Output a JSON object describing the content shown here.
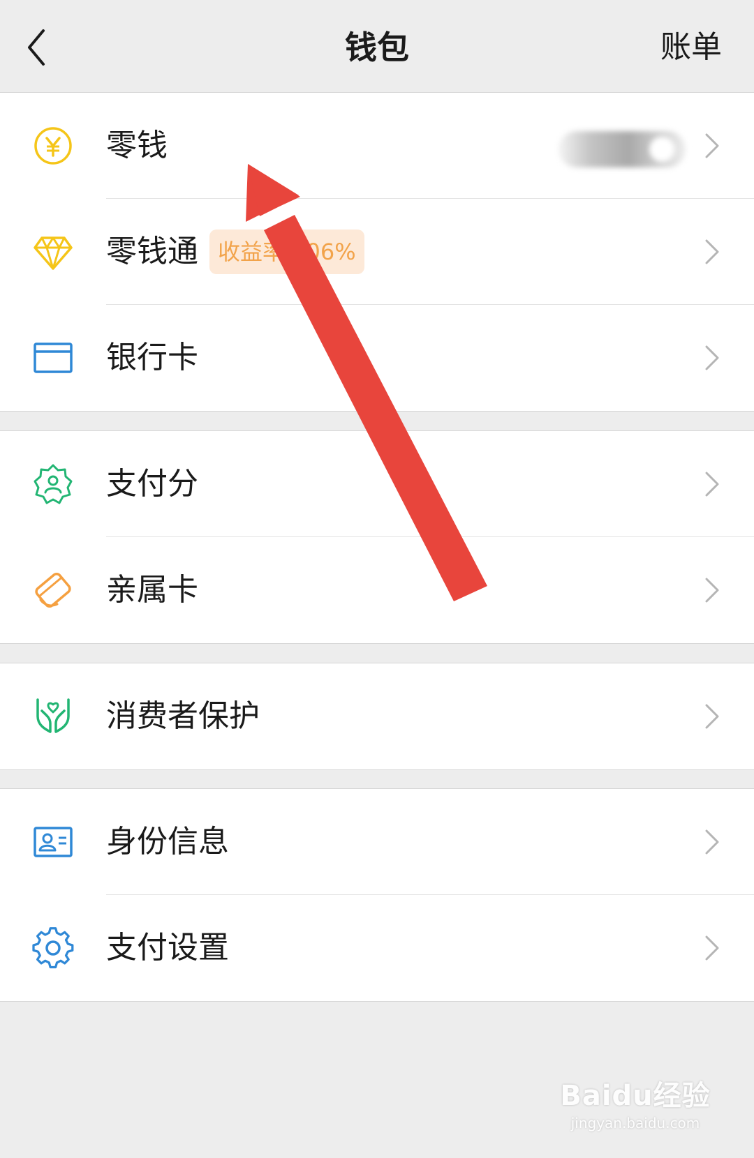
{
  "nav": {
    "title": "钱包",
    "action": "账单"
  },
  "groups": [
    {
      "items": [
        {
          "label": "零钱",
          "icon": "yuan-coin-icon",
          "color": "#f5c518"
        },
        {
          "label": "零钱通",
          "icon": "diamond-icon",
          "color": "#f5c518",
          "badge": "收益率2.06%"
        },
        {
          "label": "银行卡",
          "icon": "bank-card-icon",
          "color": "#2f88d6"
        }
      ]
    },
    {
      "items": [
        {
          "label": "支付分",
          "icon": "payment-score-badge-icon",
          "color": "#22b573"
        },
        {
          "label": "亲属卡",
          "icon": "family-card-icon",
          "color": "#f5a040"
        }
      ]
    },
    {
      "items": [
        {
          "label": "消费者保护",
          "icon": "hands-protect-icon",
          "color": "#22b573"
        }
      ]
    },
    {
      "items": [
        {
          "label": "身份信息",
          "icon": "id-card-icon",
          "color": "#2f88d6"
        },
        {
          "label": "支付设置",
          "icon": "gear-icon",
          "color": "#2f88d6"
        }
      ]
    }
  ],
  "annotation": {
    "type": "red-arrow",
    "color": "#e8453c",
    "points_to": "零钱"
  },
  "watermark": {
    "brand": "Baidu经验",
    "url": "jingyan.baidu.com"
  }
}
